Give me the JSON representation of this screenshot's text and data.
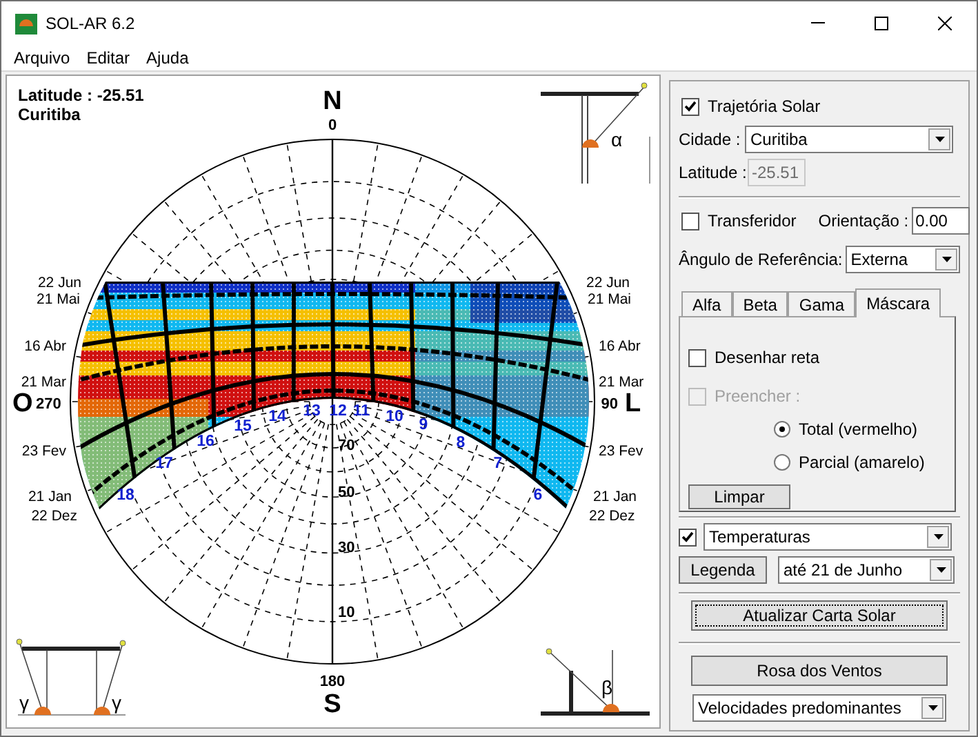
{
  "window": {
    "title": "SOL-AR 6.2"
  },
  "menu": [
    {
      "label": "Arquivo"
    },
    {
      "label": "Editar"
    },
    {
      "label": "Ajuda"
    }
  ],
  "chart": {
    "latitude": "Latitude :  -25.51",
    "city": "Curitiba",
    "north": "N",
    "north_angle": "0",
    "south": "S",
    "south_angle": "180",
    "west": "O",
    "west_angle": "270",
    "east": "L",
    "east_angle": "90",
    "dates_left": [
      "22 Jun",
      "21 Mai",
      "16 Abr",
      "21 Mar",
      "23 Fev",
      "21 Jan",
      "22 Dez"
    ],
    "dates_right": [
      "22 Jun",
      "21 Mai",
      "16 Abr",
      "21 Mar",
      "23 Fev",
      "21 Jan",
      "22 Dez"
    ],
    "hours": [
      "18",
      "17",
      "16",
      "15",
      "14",
      "13",
      "12",
      "11",
      "10",
      "9",
      "8",
      "7",
      "6"
    ],
    "altitudes": [
      "70",
      "50",
      "30",
      "10"
    ],
    "alpha": "α",
    "beta": "β",
    "gamma": [
      "γ",
      "γ"
    ]
  },
  "panel": {
    "trajectory": {
      "label": "Trajetória Solar",
      "checked": true
    },
    "city": {
      "label": "Cidade :",
      "value": "Curitiba"
    },
    "latitude": {
      "label": "Latitude :",
      "value": "-25.51",
      "disabled": true
    },
    "protractor": {
      "label": "Transferidor",
      "checked": false
    },
    "orientation": {
      "label": "Orientação :",
      "value": "0.00"
    },
    "reference": {
      "label": "Ângulo de Referência:",
      "value": "Externa"
    },
    "tabs": [
      {
        "label": "Alfa",
        "selected": false
      },
      {
        "label": "Beta",
        "selected": false
      },
      {
        "label": "Gama",
        "selected": false
      },
      {
        "label": "Máscara",
        "selected": true
      }
    ],
    "mask": {
      "draw_line": {
        "label": "Desenhar reta",
        "checked": false,
        "disabled": false
      },
      "fill": {
        "label": "Preencher :",
        "checked": false,
        "disabled": true
      },
      "options": [
        {
          "label": "Total (vermelho)",
          "selected": true
        },
        {
          "label": "Parcial (amarelo)",
          "selected": false
        }
      ],
      "clear": "Limpar"
    },
    "overlay": {
      "checked": true,
      "value": "Temperaturas"
    },
    "legend": "Legenda",
    "period": "até 21 de Junho",
    "update": "Atualizar Carta Solar",
    "wind": "Rosa dos Ventos",
    "wind_mode": "Velocidades predominantes"
  }
}
